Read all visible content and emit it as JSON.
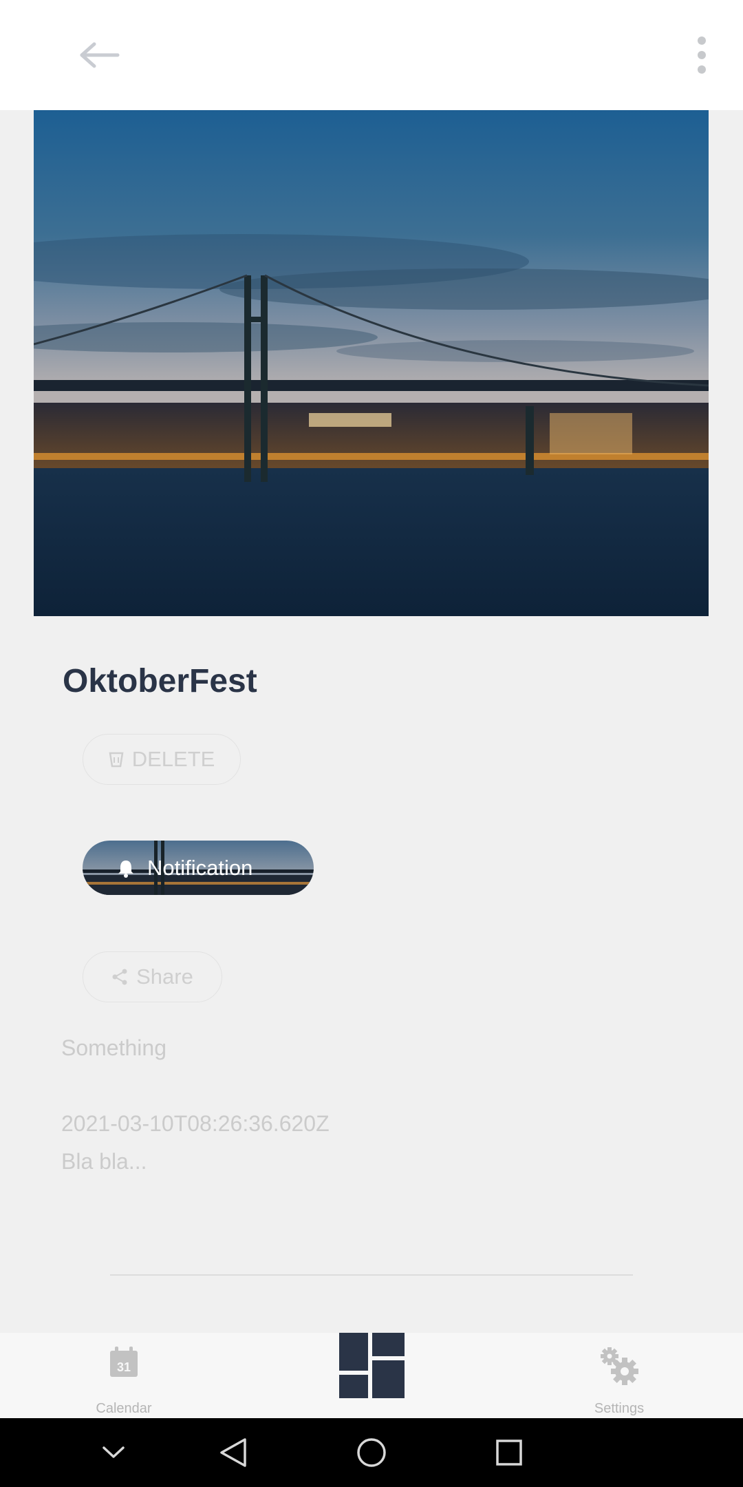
{
  "header": {
    "back_icon": "arrow-left-icon",
    "menu_icon": "more-vert-icon"
  },
  "hero": {
    "image": "bridge-at-dusk-photo"
  },
  "event": {
    "title": "OktoberFest",
    "delete_label": "DELETE",
    "notification_label": "Notification",
    "share_label": "Share",
    "description": "Something",
    "timestamp": "2021-03-10T08:26:36.620Z",
    "body": "Bla bla..."
  },
  "bottom_nav": {
    "calendar_label": "Calendar",
    "calendar_day": "31",
    "settings_label": "Settings"
  },
  "colors": {
    "title": "#2a3447",
    "muted": "#cbcbcb",
    "accent_dark": "#2a3447",
    "background": "#f0f0f0"
  }
}
